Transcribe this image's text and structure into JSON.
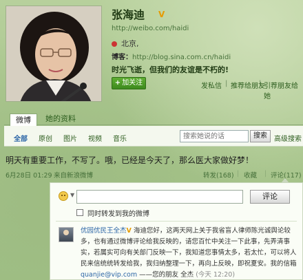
{
  "profile": {
    "name": "张海迪",
    "v_badge": "V",
    "url": "http://weibo.com/haidi",
    "location": "北京,",
    "blog_label": "博客：",
    "blog_url": "http://blog.sina.com.cn/haidi",
    "motto": "时光飞逝，但我们的友谊是不朽的!",
    "follow_button": "加关注",
    "links": [
      "发私信",
      "推荐给朋友",
      "引荐朋友给她"
    ]
  },
  "tabs": [
    "微博",
    "她的资料"
  ],
  "filters": [
    "全部",
    "原创",
    "图片",
    "视频",
    "音乐"
  ],
  "search": {
    "placeholder": "搜索她说的话",
    "button": "搜索",
    "advanced": "高级搜索"
  },
  "post": {
    "text": "明天有重要工作，不写了。哦，已经是今天了，那么医大家做好梦！",
    "date": "6月28日 01:29",
    "source": "来自新浪微博",
    "repost": "转发(168)",
    "favorite": "收藏",
    "comment": "评论(117)"
  },
  "comment_form": {
    "button": "评论",
    "repost_label": "同时转发到我的微博"
  },
  "comment": {
    "author": "优园优民王全杰",
    "v_badge": "V",
    "body": "海迪您好，这两天网上关于我省盲人律师陈光诚舆论较多，也有通过微博评论给我反映的，请您百忙中关注一下此事，先弄清事实，若属实可向有关部门反映一下，我知道您事情太多，若太忙，可以将人民来信统统转发给我，我归纳整理一下，再向上反映，即祝夏安。我的信箱",
    "email": "quanjie@vip.com",
    "signoff": "——您的朋友 全杰",
    "time": "(今天 12:20)"
  }
}
